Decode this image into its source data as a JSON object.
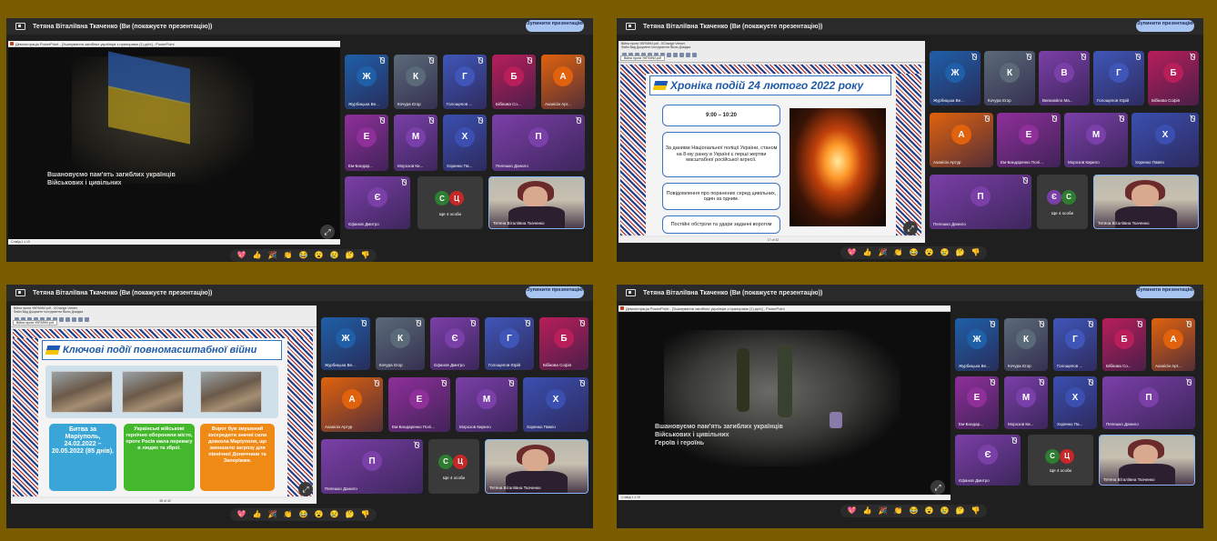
{
  "common": {
    "presenter_bar_title": "Тетяна Віталіївна Ткаченко (Ви (покажуєте презентацію))",
    "stop_button": "Зупинити презентацію",
    "reactions": [
      "💖",
      "👍",
      "🎉",
      "👏",
      "😂",
      "😮",
      "😢",
      "🤔",
      "👎"
    ],
    "memorial_line1": "Вшановуємо пам'ять загиблих українців",
    "memorial_line2": "Військових і цивільних",
    "memorial_line3b": "Героїв і героїнь",
    "more_people": "Ще 4 особи",
    "presenter_name": "Тетяна Віталіївна Ткаченко",
    "ppt_bar": "Демонстрація PowerPoint - [Ушанування загиблих українців з прапорами (1).pptx] - PowerPoint",
    "pdf_title": "Війна проти УКРАЇНИ.pdf - XChange Viewer",
    "pdf_tab": "Війна проти УКРАЇНИ.pdf",
    "pdf_menu": "Файл  Вид  Документ  Інструменти  Вікно  Довідка",
    "zoom": "По ширині",
    "slide_counter": "Слайд 1 з 19"
  },
  "panel1": {
    "participants": [
      {
        "letter": "Ж",
        "name": "Журбицька Ве...",
        "color": "#1f5fa8"
      },
      {
        "letter": "К",
        "name": "Кочура Єгор",
        "color": "#5a6a78"
      },
      {
        "letter": "Г",
        "name": "Голощепов ...",
        "color": "#3f56b8"
      },
      {
        "letter": "Б",
        "name": "Бібікова Со...",
        "color": "#b81e5a"
      },
      {
        "letter": "А",
        "name": "Аханісін Арт...",
        "color": "#e0620d"
      },
      {
        "letter": "Е",
        "name": "Ем-Бондар...",
        "color": "#8f2f9a"
      },
      {
        "letter": "М",
        "name": "Морозов Ки...",
        "color": "#7a3fa8"
      },
      {
        "letter": "Х",
        "name": "Хоренко Па...",
        "color": "#3a4fb0"
      },
      {
        "letter": "П",
        "name": "Пелешко Данило",
        "color": "#7b3fa8"
      },
      {
        "letter": "Є",
        "name": "Єфанов Дмитро",
        "color": "#7b3fa8"
      }
    ],
    "more_letters": [
      "С",
      "Ц"
    ]
  },
  "panel2": {
    "slide_title": "Хроніка подій 24 лютого 2022 року",
    "time": "9:00 – 10:20",
    "b1": "За даними Національної поліції України, станом на 8-му ранку в Україні є перші жертви масштабної російської агресії.",
    "b2": "Повідомлення про поранених серед цивільних, один за одним.",
    "b3": "Постійні обстріли та удари заданні ворогом",
    "page": "17 of 42",
    "participants": [
      {
        "letter": "Ж",
        "name": "Журбицька Ве...",
        "color": "#1f5fa8"
      },
      {
        "letter": "К",
        "name": "Кочура Єгор",
        "color": "#5a6a78"
      },
      {
        "letter": "В",
        "name": "Виганайло Ма...",
        "color": "#7b3fa8"
      },
      {
        "letter": "Г",
        "name": "Голощепов Юрій",
        "color": "#3f56b8"
      },
      {
        "letter": "Б",
        "name": "Бібікова Софія",
        "color": "#b81e5a"
      },
      {
        "letter": "А",
        "name": "Аханісін Артур",
        "color": "#e0620d"
      },
      {
        "letter": "Е",
        "name": "Ем-Бондаренко Полі...",
        "color": "#8f2f9a"
      },
      {
        "letter": "М",
        "name": "Морозов Кирило",
        "color": "#7a3fa8"
      },
      {
        "letter": "Х",
        "name": "Хоренко Павло",
        "color": "#3a4fb0"
      },
      {
        "letter": "П",
        "name": "Пелешко Данило",
        "color": "#7b3fa8"
      }
    ],
    "more_letters": [
      "Є",
      "С"
    ]
  },
  "panel3": {
    "slide_title": "Ключові події повномасштабної війни",
    "c1": "Битва за Маріуполь, 24.02.2022 – 20.05.2022 (85 днів).",
    "c2": "Українські військові героїчно обороняли місто, проте Росія мала перевагу в людях та зброї.",
    "c3": "Ворог був змушений зосередити значні сили довкола Маріуполя, що зменшило загрозу для північної Донеччини та Запоріжжя.",
    "page": "38 of 42",
    "participants": [
      {
        "letter": "Ж",
        "name": "Журбицька Ве...",
        "color": "#1f5fa8"
      },
      {
        "letter": "К",
        "name": "Кочура Єгор",
        "color": "#5a6a78"
      },
      {
        "letter": "Є",
        "name": "Єфанов Дмитро",
        "color": "#7b3fa8"
      },
      {
        "letter": "Г",
        "name": "Голощепов Юрій",
        "color": "#3f56b8"
      },
      {
        "letter": "Б",
        "name": "Бібікова Софія",
        "color": "#b81e5a"
      },
      {
        "letter": "А",
        "name": "Аханісін Артур",
        "color": "#e0620d"
      },
      {
        "letter": "Е",
        "name": "Ем-Бондаренко Полі...",
        "color": "#8f2f9a"
      },
      {
        "letter": "М",
        "name": "Морозов Кирило",
        "color": "#7a3fa8"
      },
      {
        "letter": "Х",
        "name": "Хоренко Павло",
        "color": "#3a4fb0"
      },
      {
        "letter": "П",
        "name": "Пелешко Данило",
        "color": "#7b3fa8"
      }
    ],
    "more_letters": [
      "С",
      "Ц"
    ]
  },
  "panel4": {
    "participants": [
      {
        "letter": "Ж",
        "name": "Журбицька Ве...",
        "color": "#1f5fa8"
      },
      {
        "letter": "К",
        "name": "Кочура Єгор",
        "color": "#5a6a78"
      },
      {
        "letter": "Г",
        "name": "Голощепов ...",
        "color": "#3f56b8"
      },
      {
        "letter": "Б",
        "name": "Бібікова Со...",
        "color": "#b81e5a"
      },
      {
        "letter": "А",
        "name": "Аханісін Арт...",
        "color": "#e0620d"
      },
      {
        "letter": "Е",
        "name": "Ем-Бондар...",
        "color": "#8f2f9a"
      },
      {
        "letter": "М",
        "name": "Морозов Ки...",
        "color": "#7a3fa8"
      },
      {
        "letter": "Х",
        "name": "Хоренко Па...",
        "color": "#3a4fb0"
      },
      {
        "letter": "П",
        "name": "Пелешко Данило",
        "color": "#7b3fa8"
      },
      {
        "letter": "Є",
        "name": "Єфанов Дмитро",
        "color": "#7b3fa8"
      }
    ],
    "more_letters": [
      "С",
      "Ц"
    ]
  }
}
